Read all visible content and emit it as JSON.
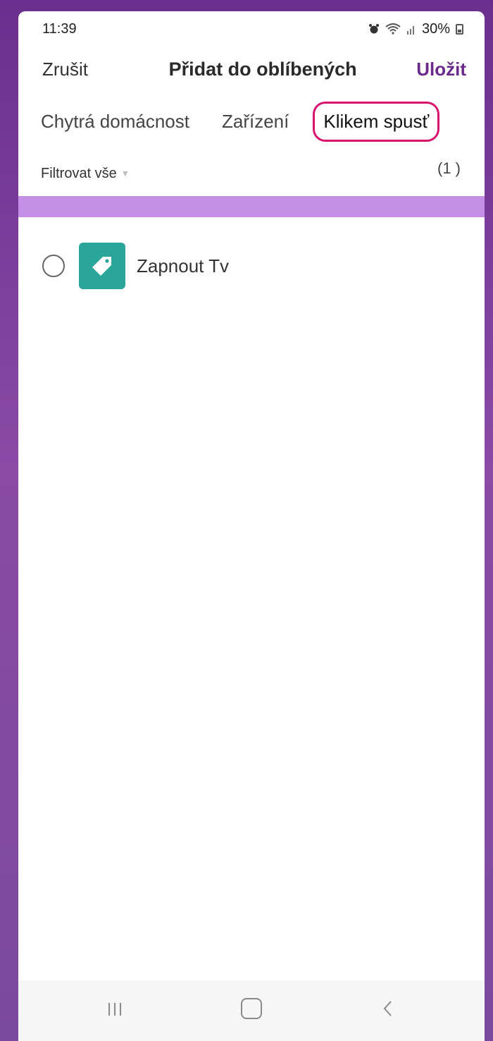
{
  "status_bar": {
    "time": "11:39",
    "battery_percent": "30%",
    "icons": [
      "alarm-icon",
      "wifi-icon",
      "signal-icon",
      "battery-icon"
    ]
  },
  "header": {
    "cancel_label": "Zrušit",
    "title": "Přidat do oblíbených",
    "save_label": "Uložit"
  },
  "tabs": [
    {
      "label": "Chytrá domácnost",
      "active": false
    },
    {
      "label": "Zařízení",
      "active": false
    },
    {
      "label": "Klikem spusť",
      "active": true
    }
  ],
  "filter": {
    "label": "Filtrovat vše",
    "count": "(1 )"
  },
  "list_items": [
    {
      "label": "Zapnout Tv",
      "icon": "tag-icon",
      "selected": false
    }
  ],
  "colors": {
    "accent_purple": "#6a2a8a",
    "highlight_pink": "#d8146e",
    "bar_purple": "#c48fe6",
    "icon_teal": "#2aa59a"
  },
  "nav_bar": {
    "icons": [
      "recent-apps-icon",
      "home-icon",
      "back-icon"
    ]
  }
}
